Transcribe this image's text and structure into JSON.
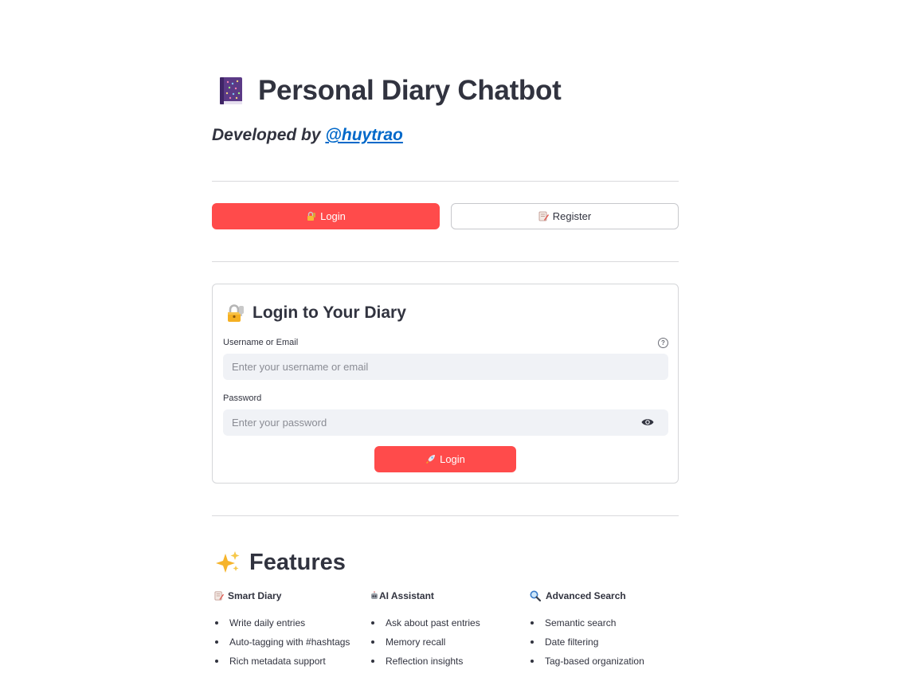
{
  "header": {
    "icon": "closed-book-icon",
    "title": "Personal Diary Chatbot",
    "subtitle_prefix": "Developed by",
    "author_link": "@huytrao"
  },
  "mode_tabs": {
    "login_label": "Login",
    "login_icon": "locked-with-key-icon",
    "register_label": "Register",
    "register_icon": "memo-icon"
  },
  "login_form": {
    "heading": "Login to Your Diary",
    "heading_icon": "locked-with-key-icon",
    "username_label": "Username or Email",
    "username_placeholder": "Enter your username or email",
    "username_value": "",
    "password_label": "Password",
    "password_placeholder": "Enter your password",
    "password_value": "",
    "submit_label": "Login",
    "submit_icon": "rocket-icon"
  },
  "features": {
    "title": "Features",
    "title_icon": "sparkles-icon",
    "columns": [
      {
        "heading": "Smart Diary",
        "icon": "memo-icon",
        "items": [
          "Write daily entries",
          "Auto-tagging with #hashtags",
          "Rich metadata support"
        ]
      },
      {
        "heading": "AI Assistant",
        "icon": "robot-icon",
        "items": [
          "Ask about past entries",
          "Memory recall",
          "Reflection insights"
        ]
      },
      {
        "heading": "Advanced Search",
        "icon": "magnifier-icon",
        "items": [
          "Semantic search",
          "Date filtering",
          "Tag-based organization"
        ]
      }
    ]
  },
  "colors": {
    "primary": "#ff4b4b",
    "text": "#31333f",
    "link": "#0068c9",
    "input_bg": "#f0f2f6",
    "divider": "#d9dadc"
  }
}
